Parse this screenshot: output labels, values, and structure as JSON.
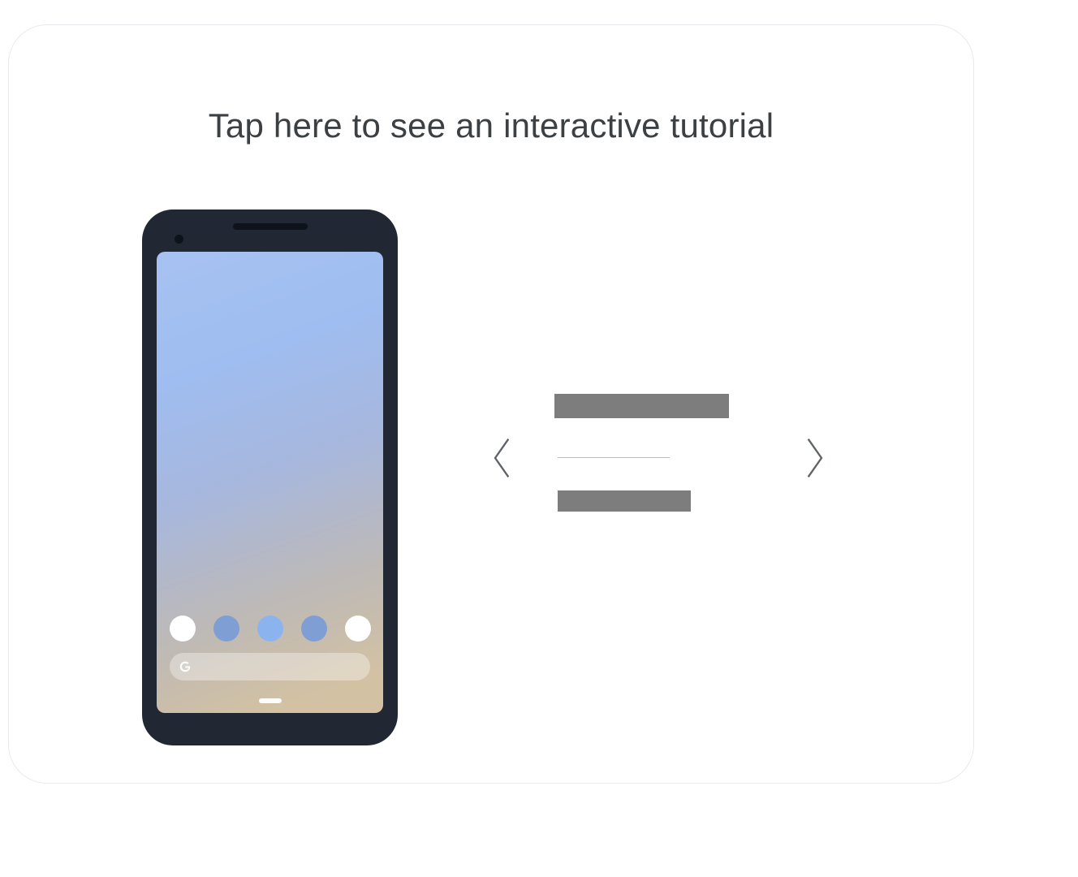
{
  "headline": "Tap here to see an interactive tutorial",
  "phone": {
    "dock_colors": [
      "#ffffff",
      "#7f9ed3",
      "#8bb4ef",
      "#7f9ed3",
      "#ffffff"
    ],
    "search_placeholder": "",
    "search_logo_label": "G"
  },
  "nav": {
    "prev_label": "Previous",
    "next_label": "Next"
  }
}
